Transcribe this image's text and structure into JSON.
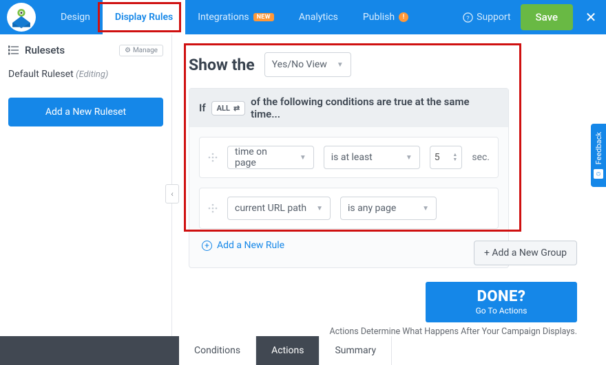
{
  "nav": {
    "design": "Design",
    "display_rules": "Display Rules",
    "integrations": "Integrations",
    "integrations_badge": "NEW",
    "analytics": "Analytics",
    "publish": "Publish",
    "publish_badge": "!"
  },
  "top_right": {
    "support": "Support",
    "save": "Save"
  },
  "sidebar": {
    "title": "Rulesets",
    "manage": "Manage",
    "default_ruleset": "Default Ruleset",
    "editing": "(Editing)",
    "add_button": "Add a New Ruleset"
  },
  "main": {
    "show_the": "Show the",
    "view_dd": "Yes/No View",
    "if": "If",
    "all": "ALL",
    "cond_text": "of the following conditions are true at the same time...",
    "rule1_field": "time on page",
    "rule1_op": "is at least",
    "rule1_val": "5",
    "rule1_unit": "sec.",
    "rule2_field": "current URL path",
    "rule2_op": "is any page",
    "add_rule": "Add a New Rule",
    "add_group": "+ Add a New Group",
    "done_title": "DONE?",
    "done_sub": "Go To Actions",
    "hint": "Actions Determine What Happens After Your Campaign Displays."
  },
  "bottom": {
    "conditions": "Conditions",
    "actions": "Actions",
    "summary": "Summary"
  },
  "feedback": "Feedback"
}
